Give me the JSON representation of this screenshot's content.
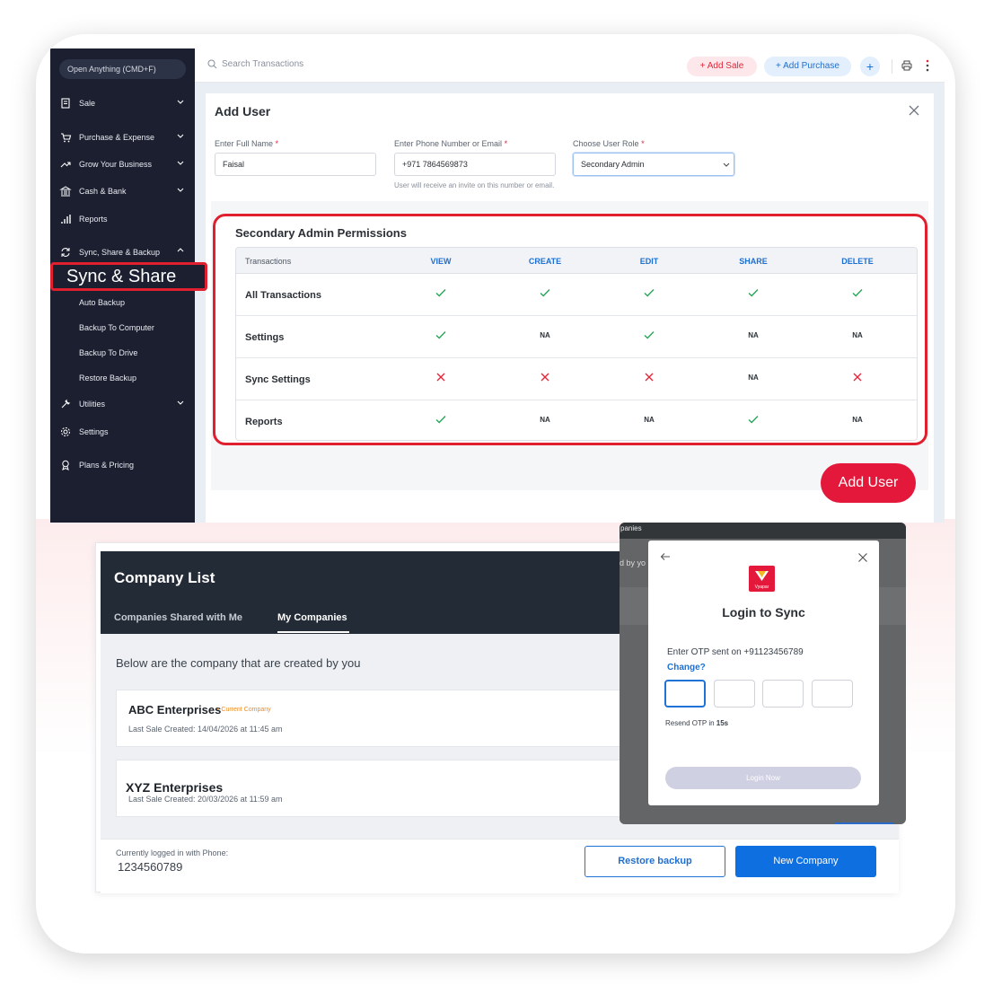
{
  "sidebar": {
    "search_label": "Open Anything (CMD+F)",
    "items": [
      {
        "label": "Sale",
        "icon": "receipt-icon"
      },
      {
        "label": "Purchase & Expense",
        "icon": "cart-icon"
      },
      {
        "label": "Grow Your Business",
        "icon": "trend-icon"
      },
      {
        "label": "Cash & Bank",
        "icon": "bank-icon"
      },
      {
        "label": "Reports",
        "icon": "bar-chart-icon"
      },
      {
        "label": "Sync, Share & Backup",
        "icon": "sync-icon"
      },
      {
        "label": "Utilities",
        "icon": "tools-icon"
      },
      {
        "label": "Settings",
        "icon": "gear-icon"
      },
      {
        "label": "Plans & Pricing",
        "icon": "award-icon"
      }
    ],
    "highlight_label": "Sync & Share",
    "sub_items": [
      "Auto Backup",
      "Backup To Computer",
      "Backup To Drive",
      "Restore Backup"
    ]
  },
  "topbar": {
    "search_placeholder": "Search Transactions",
    "add_sale": "+ Add Sale",
    "add_purchase": "+ Add Purchase",
    "plus": "+"
  },
  "add_user": {
    "title": "Add User",
    "name_label": "Enter Full Name",
    "name_value": "Faisal",
    "contact_label": "Enter Phone Number or Email",
    "contact_value": "+971 7864569873",
    "helper_text": "User will receive an invite on this number or email.",
    "role_label": "Choose User Role",
    "role_value": "Secondary Admin",
    "required_mark": "*",
    "submit_label": "Add User"
  },
  "permissions": {
    "title": "Secondary Admin Permissions",
    "columns": [
      "Transactions",
      "VIEW",
      "CREATE",
      "EDIT",
      "SHARE",
      "DELETE"
    ],
    "rows": [
      {
        "label": "All Transactions",
        "cells": [
          "check",
          "check",
          "check",
          "check",
          "check"
        ]
      },
      {
        "label": "Settings",
        "cells": [
          "check",
          "NA",
          "check",
          "NA",
          "NA"
        ]
      },
      {
        "label": "Sync Settings",
        "cells": [
          "cross",
          "cross",
          "cross",
          "NA",
          "cross"
        ]
      },
      {
        "label": "Reports",
        "cells": [
          "check",
          "NA",
          "NA",
          "check",
          "NA"
        ]
      }
    ],
    "colors": {
      "check": "#2aa55a",
      "cross": "#e3263a"
    }
  },
  "company_list": {
    "title": "Company List",
    "tabs": [
      "Companies Shared with Me",
      "My Companies"
    ],
    "active_tab": "My Companies",
    "intro": "Below are the company that are created by you",
    "companies": [
      {
        "name": "ABC Enterprises",
        "badge": "• Current Company",
        "sub": "Last Sale Created: 14/04/2026 at 11:45 am"
      },
      {
        "name": "XYZ Enterprises",
        "badge": "",
        "sub": "Last Sale Created: 20/03/2026 at 11:59 am"
      }
    ],
    "logged_label": "Currently logged in with Phone:",
    "logged_phone": "1234560789",
    "restore_label": "Restore backup",
    "new_label": "New Company"
  },
  "login_sync": {
    "ghost_top": "panies",
    "ghost_mid": "d by yo",
    "logo_text": "Vyapar",
    "title": "Login to Sync",
    "otp_sent": "Enter OTP sent on +91123456789",
    "change_label": "Change?",
    "resend_prefix": "Resend OTP in",
    "resend_time": "15s",
    "login_button": "Login Now"
  },
  "colors": {
    "accent_red": "#e3183a",
    "accent_blue": "#0e6fe0",
    "sidebar_bg": "#1b1f30"
  }
}
